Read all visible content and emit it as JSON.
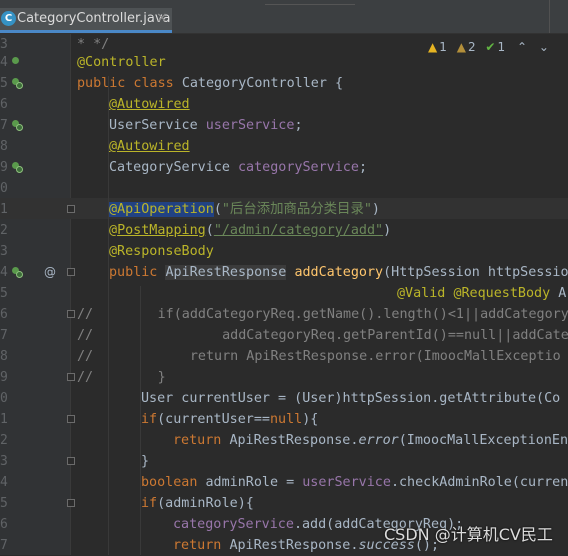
{
  "tab": {
    "icon_letter": "C",
    "file_name": "CategoryController.java",
    "close": "×"
  },
  "inspections": {
    "warnings": "1",
    "weak_warnings": "2",
    "typos": "1",
    "prev": "⌃",
    "next": "⌄"
  },
  "lines": [
    {
      "num": "3",
      "text": "* */"
    },
    {
      "num": "4",
      "text": "@Controller"
    },
    {
      "num": "5",
      "text": "public class CategoryController {"
    },
    {
      "num": "6",
      "text": "@Autowired"
    },
    {
      "num": "7",
      "text": "UserService userService;"
    },
    {
      "num": "8",
      "text": "@Autowired"
    },
    {
      "num": "9",
      "text": "CategoryService categoryService;"
    },
    {
      "num": "0",
      "text": ""
    },
    {
      "num": "1",
      "text": "@ApiOperation(\"后台添加商品分类目录\")"
    },
    {
      "num": "2",
      "text": "@PostMapping(\"/admin/category/add\")"
    },
    {
      "num": "3",
      "text": "@ResponseBody"
    },
    {
      "num": "4",
      "text": "public ApiRestResponse addCategory(HttpSession httpSessio"
    },
    {
      "num": "5",
      "text": "@Valid @RequestBody A"
    },
    {
      "num": "6",
      "text": "//        if(addCategoryReq.getName().length()<1||addCategory"
    },
    {
      "num": "7",
      "text": "//                addCategoryReq.getParentId()==null||addCate"
    },
    {
      "num": "8",
      "text": "//            return ApiRestResponse.error(ImoocMallExceptio"
    },
    {
      "num": "9",
      "text": "//        }"
    },
    {
      "num": "0",
      "text": "User currentUser = (User)httpSession.getAttribute(Co"
    },
    {
      "num": "1",
      "text": "if(currentUser==null){"
    },
    {
      "num": "2",
      "text": "return ApiRestResponse.error(ImoocMallExceptionEn"
    },
    {
      "num": "3",
      "text": "}"
    },
    {
      "num": "4",
      "text": "boolean adminRole = userService.checkAdminRole(curren"
    },
    {
      "num": "5",
      "text": "if(adminRole){"
    },
    {
      "num": "6",
      "text": "categoryService.add(addCategoryReq);"
    },
    {
      "num": "7",
      "text": "return ApiRestResponse.success();"
    }
  ],
  "tokens": {
    "at": "@",
    "controller": "Controller",
    "autowired": "@Autowired",
    "user_service_type": "UserService",
    "user_service_field": "userService",
    "category_service_type": "CategoryService",
    "category_service_field": "categoryService",
    "api_operation": "ApiOperation",
    "api_operation_str": "\"后台添加商品分类目录\"",
    "post_mapping": "PostMapping",
    "post_mapping_str": "\"/admin/category/add\"",
    "response_body": "@ResponseBody",
    "api_rest_response": "ApiRestResponse",
    "add_category": "addCategory",
    "valid": "@Valid",
    "request_body": "@RequestBody",
    "error": "error",
    "success": "success"
  },
  "watermark": "CSDN @计算机CV民工"
}
